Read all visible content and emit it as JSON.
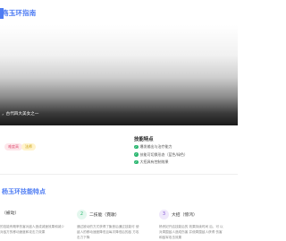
{
  "header": {
    "title": "殇玉环指南"
  },
  "hero": {
    "caption": "，古代四大美女之一"
  },
  "tags": [
    "难度高",
    "法师"
  ],
  "features": {
    "title": "技能特点",
    "items": [
      "爆发输出与治疗能力",
      "技能可切换形态（蓝色/绿色）",
      "大招具有控制效果"
    ]
  },
  "skills_section": {
    "title": "杨玉环技能特点"
  },
  "skills": [
    {
      "num": "",
      "name": "（被动）",
      "desc": "的技能有概率伤害对敌人造成减速效果和减少 对敌方的移动速度和攻击力效果"
    },
    {
      "num": "2",
      "name": "二技能（霓歌）",
      "desc": "通过被动的方式获得了聚音后通过技能可 使敌人的移动速度降低且每次降低后的敌 方攻击力下降"
    },
    {
      "num": "3",
      "name": "大招（惊鸿）",
      "desc": "杨贵妃开启技能后的 效果持续时间 后，可 以对周围敌人造成伤害 并使周围敌人获得 伤害和敌军攻击效果"
    }
  ],
  "colors": {
    "accent": "#4f7df3",
    "check": "#2eb872"
  }
}
